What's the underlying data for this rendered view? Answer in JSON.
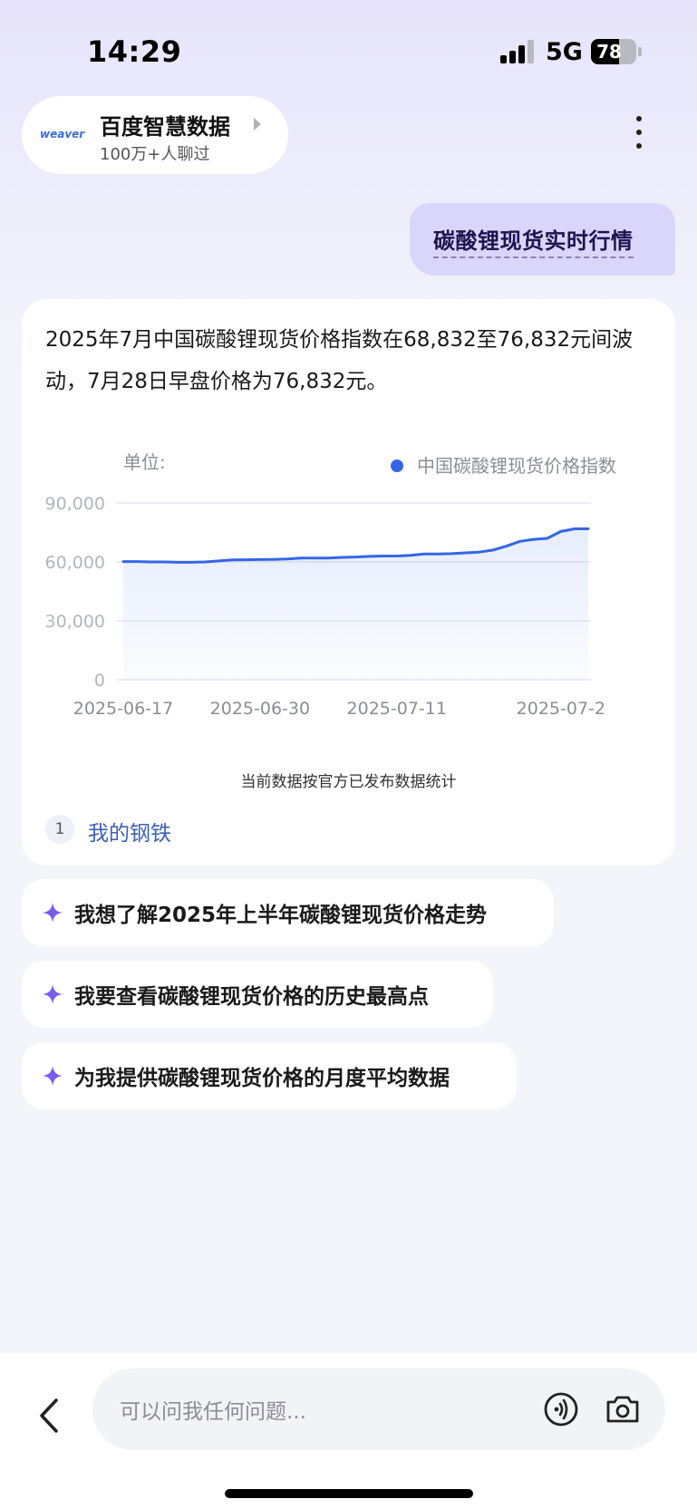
{
  "status_bar": {
    "time": "14:29",
    "network": "5G",
    "battery": "78",
    "battery_level": 0.78
  },
  "header": {
    "logo_text": "weaver",
    "agent_name": "百度智慧数据",
    "agent_subtitle": "100万+人聊过",
    "icons": {
      "more": "more-vertical-icon",
      "arrow": "chevron-right-icon"
    }
  },
  "user_message": {
    "text": "碳酸锂现货实时行情"
  },
  "answer": {
    "text": "2025年7月中国碳酸锂现货价格指数在68,832至76,832元间波动，7月28日早盘价格为76,832元。",
    "chart_note": "当前数据按官方已发布数据统计",
    "reference": {
      "index": "1",
      "label": "我的钢铁"
    }
  },
  "chart_data": {
    "type": "area",
    "unit_label": "单位:",
    "legend": {
      "label": "中国碳酸锂现货价格指数",
      "position": "top-right"
    },
    "series": [
      {
        "name": "中国碳酸锂现货价格指数",
        "color": "#3566e6",
        "values": [
          60200,
          60200,
          60000,
          60000,
          59800,
          59800,
          60000,
          60500,
          61000,
          61100,
          61200,
          61300,
          61500,
          62000,
          62000,
          62000,
          62300,
          62500,
          62800,
          63000,
          63000,
          63300,
          64000,
          64000,
          64200,
          64600,
          65000,
          66000,
          68000,
          70500,
          71500,
          72000,
          75500,
          76832,
          76832
        ]
      }
    ],
    "x_tick_labels": [
      "2025-06-17",
      "2025-06-30",
      "2025-07-11",
      "2025-07-2"
    ],
    "x_tick_index": [
      0,
      10,
      20,
      32
    ],
    "y_ticks": [
      "0",
      "30,000",
      "60,000",
      "90,000"
    ],
    "y_tick_values": [
      0,
      30000,
      60000,
      90000
    ],
    "ylim": [
      0,
      90000
    ],
    "grid": true
  },
  "suggestions": [
    {
      "text": "我想了解2025年上半年碳酸锂现货价格走势"
    },
    {
      "text": "我要查看碳酸锂现货价格的历史最高点"
    },
    {
      "text": "为我提供碳酸锂现货价格的月度平均数据"
    }
  ],
  "input": {
    "placeholder": "可以问我任何问题..."
  },
  "colors": {
    "accent": "#3566e6",
    "user_bubble": "#dad5fb",
    "spark": "#7a5cf0",
    "link": "#3b5fb8"
  }
}
